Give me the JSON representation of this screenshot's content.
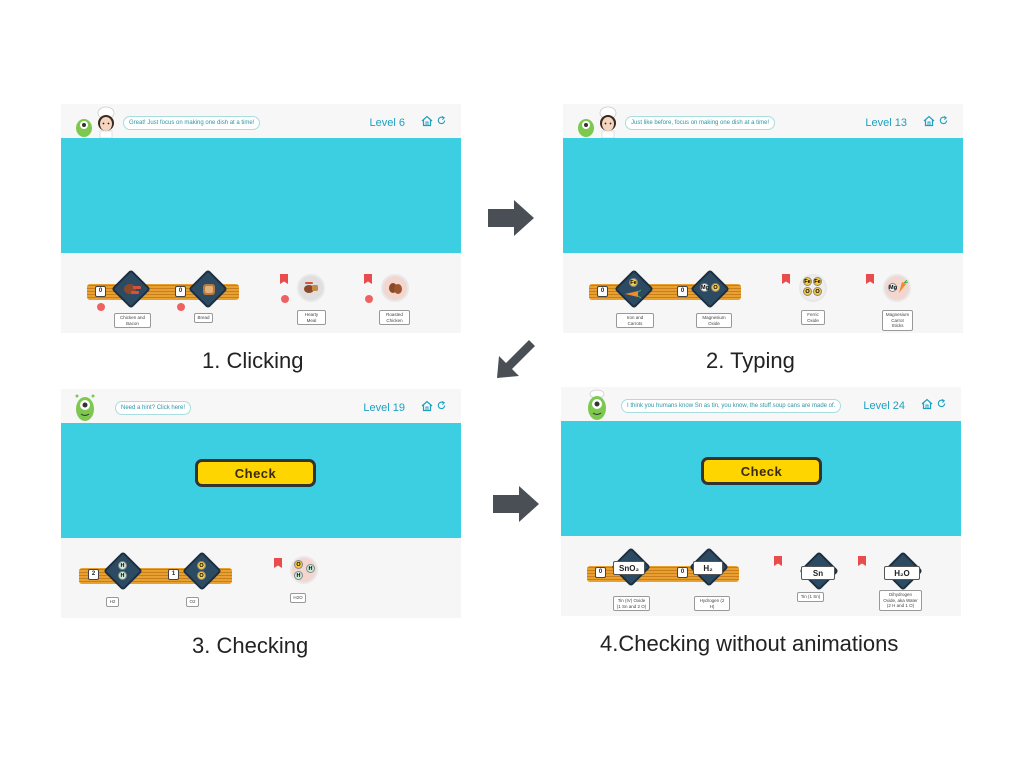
{
  "panels": [
    {
      "message": "Great! Just focus on making one dish at a time!",
      "level": "Level 6",
      "caption": "1. Clicking",
      "orders": [
        {
          "count": "0",
          "label": "Chicken and\nBacon"
        },
        {
          "count": "0",
          "label": "Bread"
        }
      ],
      "dishes": [
        {
          "label": "Hearty\nMeal"
        },
        {
          "label": "Roasted\nChicken"
        }
      ]
    },
    {
      "message": "Just like before, focus on making one dish at a time!",
      "level": "Level 13",
      "caption": "2. Typing",
      "orders": [
        {
          "count": "0",
          "label": "Iron and Carrots"
        },
        {
          "count": "0",
          "label": "Magnesium\nOxide"
        }
      ],
      "dishes": [
        {
          "label": "Ferric\nOxide"
        },
        {
          "label": "Magnesium\nCarrot\nSticks"
        }
      ]
    },
    {
      "message": "Need a hint? Click here!",
      "level": "Level 19",
      "caption": "3. Checking",
      "check_label": "Check",
      "orders": [
        {
          "count": "2",
          "label": "H2"
        },
        {
          "count": "1",
          "label": "O2"
        }
      ],
      "dishes": [
        {
          "label": "H2O"
        }
      ]
    },
    {
      "message": "I think you humans know Sn as tin, you know, the stuff soup cans are made of.",
      "level": "Level 24",
      "caption": "4.Checking without animations",
      "check_label": "Check",
      "orders": [
        {
          "count": "0",
          "formula": "SnO₂",
          "label": "Tin (IV) Oxide\n(1 Sn and 2 O)"
        },
        {
          "count": "0",
          "formula": "H₂",
          "label": "Hydrogen (2\nH)"
        }
      ],
      "dishes": [
        {
          "formula": "Sn",
          "label": "Tin (1 Sn)"
        },
        {
          "formula": "H₂O",
          "label": "Dihydrogen\nOxide, aka Water\n(2 H and 1 O)"
        }
      ]
    }
  ],
  "atoms": {
    "fe": "Fe",
    "mg": "Mg",
    "o": "O",
    "h": "H"
  },
  "colors": {
    "stage": "#3ccfe2",
    "level_text": "#1e9fc0",
    "check_button": "#ffd500",
    "belt": "#e8a030",
    "arrow": "#4a4f55"
  }
}
